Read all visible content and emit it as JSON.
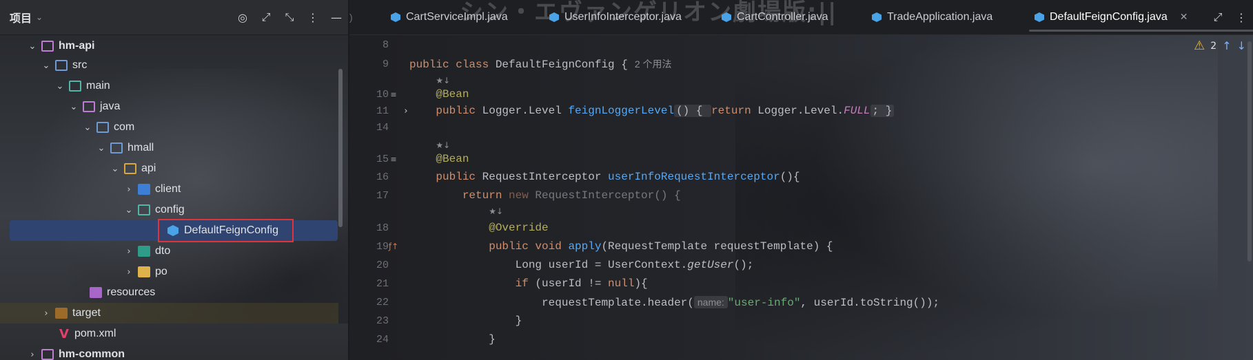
{
  "panel": {
    "title": "项目",
    "tree": [
      {
        "label": "hm-api",
        "arrow": "⌄",
        "bold": true
      },
      {
        "label": "src",
        "arrow": "⌄"
      },
      {
        "label": "main",
        "arrow": "⌄"
      },
      {
        "label": "java",
        "arrow": "⌄"
      },
      {
        "label": "com",
        "arrow": "⌄"
      },
      {
        "label": "hmall",
        "arrow": "⌄"
      },
      {
        "label": "api",
        "arrow": "⌄"
      },
      {
        "label": "client",
        "arrow": "›"
      },
      {
        "label": "config",
        "arrow": "⌄"
      },
      {
        "label": "DefaultFeignConfig",
        "arrow": "",
        "selected": true
      },
      {
        "label": "dto",
        "arrow": "›"
      },
      {
        "label": "po",
        "arrow": "›"
      },
      {
        "label": "resources",
        "arrow": ""
      },
      {
        "label": "target",
        "arrow": "›"
      },
      {
        "label": "pom.xml",
        "arrow": ""
      },
      {
        "label": "hm-common",
        "arrow": "›",
        "bold": true
      }
    ]
  },
  "tabs": [
    {
      "label": "CartServiceImpl.java"
    },
    {
      "label": "UserInfoInterceptor.java"
    },
    {
      "label": "CartController.java"
    },
    {
      "label": "TradeApplication.java"
    },
    {
      "label": "DefaultFeignConfig.java",
      "active": true
    }
  ],
  "banner_ghost": "シン・エヴァンゲリオン劇場版:||",
  "warnings": {
    "count": "2"
  },
  "code": {
    "line_numbers": [
      "8",
      "9",
      "10",
      "11",
      "14",
      "15",
      "16",
      "17",
      "18",
      "19",
      "20",
      "21",
      "22",
      "23",
      "24"
    ],
    "usage_hint": "2 个用法",
    "param_hint": "name:",
    "class_kw": "public class",
    "class_name": "DefaultFeignConfig {",
    "bean": "@Bean",
    "public_kw": "public",
    "logger_type": " Logger.Level ",
    "logger_fn": "feignLoggerLevel",
    "logger_body_open": "() { ",
    "return_kw": "return",
    "logger_level": " Logger.Level.",
    "full": "FULL",
    "logger_body_close": "; }",
    "interceptor_type": " RequestInterceptor ",
    "interceptor_fn": "userInfoRequestInterceptor",
    "interceptor_tail": "(){",
    "new_kw": " new",
    "new_tail": " RequestInterceptor() {",
    "override": "@Override",
    "public_void": "public void",
    "apply_fn": " apply",
    "apply_tail": "(RequestTemplate requestTemplate) {",
    "long_line": "Long userId = UserContext.",
    "getuser": "getUser",
    "getuser_tail": "();",
    "if_kw": "if",
    "if_mid": " (userId != ",
    "null_kw": "null",
    "if_tail": "){",
    "header_call": "requestTemplate.header(",
    "header_str": "\"user-info\"",
    "header_tail": ", userId.toString());",
    "close_brace": "}"
  }
}
